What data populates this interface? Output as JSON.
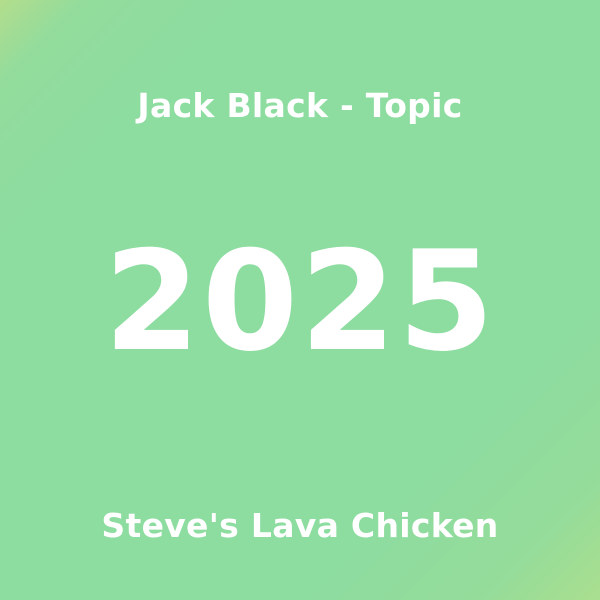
{
  "cover": {
    "artist_line": "Jack Black - Topic",
    "year": "2025",
    "title": "Steve's Lava Chicken"
  },
  "colors": {
    "background": "#8ddca0",
    "corner_tint": "#b3dd8c",
    "text": "#ffffff"
  }
}
